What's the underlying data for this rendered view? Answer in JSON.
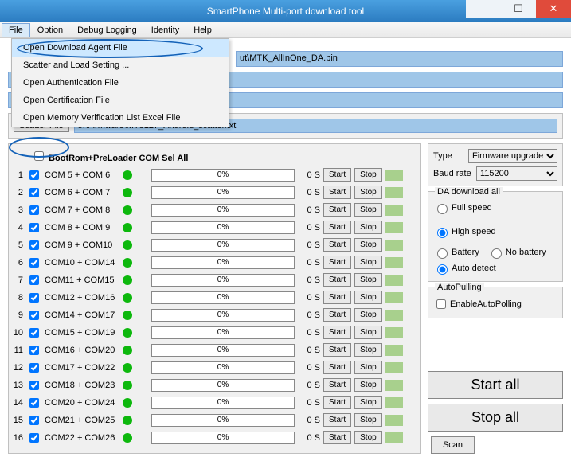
{
  "window": {
    "title": "SmartPhone Multi-port download tool"
  },
  "menu": {
    "file": "File",
    "option": "Option",
    "debug": "Debug Logging",
    "identity": "Identity",
    "help": "Help"
  },
  "file_menu": {
    "open_da": "Open Download Agent File",
    "scatter_load": "Scatter and Load Setting ...",
    "open_auth": "Open Authentication File",
    "open_cert": "Open Certification File",
    "open_memver": "Open Memory Verification List Excel File"
  },
  "paths": {
    "da_bin": "ut\\MTK_AllInOne_DA.bin",
    "scatter_btn": "Scatter File",
    "scatter_path": "5:\\Firmware\\MT8127_Android_scatter.txt"
  },
  "header": {
    "bootrom": "BootRom+PreLoader COM Sel All"
  },
  "ports": [
    {
      "n": "1",
      "label": "COM 5 + COM 6"
    },
    {
      "n": "2",
      "label": "COM 6 + COM 7"
    },
    {
      "n": "3",
      "label": "COM 7 + COM 8"
    },
    {
      "n": "4",
      "label": "COM 8 + COM 9"
    },
    {
      "n": "5",
      "label": "COM 9 + COM10"
    },
    {
      "n": "6",
      "label": "COM10 + COM14"
    },
    {
      "n": "7",
      "label": "COM11 + COM15"
    },
    {
      "n": "8",
      "label": "COM12 + COM16"
    },
    {
      "n": "9",
      "label": "COM14 + COM17"
    },
    {
      "n": "10",
      "label": "COM15 + COM19"
    },
    {
      "n": "11",
      "label": "COM16 + COM20"
    },
    {
      "n": "12",
      "label": "COM17 + COM22"
    },
    {
      "n": "13",
      "label": "COM18 + COM23"
    },
    {
      "n": "14",
      "label": "COM20 + COM24"
    },
    {
      "n": "15",
      "label": "COM21 + COM25"
    },
    {
      "n": "16",
      "label": "COM22 + COM26"
    }
  ],
  "row_common": {
    "pct": "0%",
    "secs": "0 S",
    "start": "Start",
    "stop": "Stop"
  },
  "config": {
    "type_label": "Type",
    "type_value": "Firmware upgrade",
    "baud_label": "Baud rate",
    "baud_value": "115200"
  },
  "da_group": {
    "title": "DA download all",
    "full": "Full speed",
    "high": "High speed",
    "batt": "Battery",
    "nobatt": "No battery",
    "auto": "Auto detect"
  },
  "autopull": {
    "title": "AutoPulling",
    "enable": "EnableAutoPolling"
  },
  "actions": {
    "startall": "Start all",
    "stopall": "Stop all",
    "scan": "Scan"
  }
}
